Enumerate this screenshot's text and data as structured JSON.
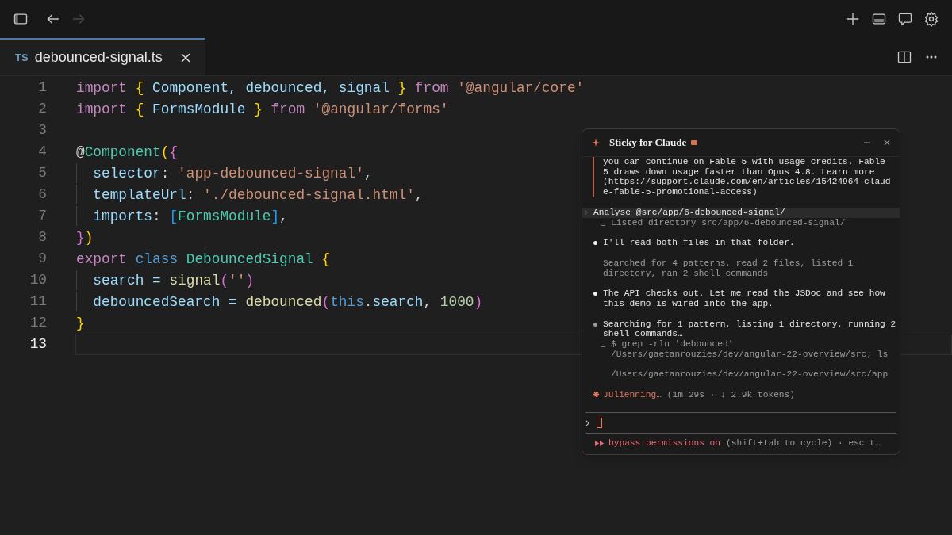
{
  "nav": {
    "back_disabled": false,
    "forward_disabled": true
  },
  "tab": {
    "lang": "TS",
    "label": "debounced-signal.ts",
    "selected": true
  },
  "editor": {
    "lines": [
      {
        "number": "1",
        "current": false,
        "indent_guide": false,
        "tokens": [
          {
            "text": "import ",
            "kind": "kw"
          },
          {
            "text": "{",
            "kind": "brace"
          },
          {
            "text": " Component, debounced, signal ",
            "kind": "id"
          },
          {
            "text": "}",
            "kind": "brace"
          },
          {
            "text": " from ",
            "kind": "kw"
          },
          {
            "text": "'@angular/core'",
            "kind": "str"
          }
        ]
      },
      {
        "number": "2",
        "current": false,
        "indent_guide": false,
        "tokens": [
          {
            "text": "import ",
            "kind": "kw"
          },
          {
            "text": "{",
            "kind": "brace"
          },
          {
            "text": " FormsModule ",
            "kind": "id"
          },
          {
            "text": "}",
            "kind": "brace"
          },
          {
            "text": " from ",
            "kind": "kw"
          },
          {
            "text": "'@angular/forms'",
            "kind": "str"
          }
        ]
      },
      {
        "number": "3",
        "current": false,
        "indent_guide": false
      },
      {
        "number": "4",
        "current": false,
        "indent_guide": false,
        "tokens": [
          {
            "text": "@",
            "kind": "plain"
          },
          {
            "text": "Component",
            "kind": "cls"
          },
          {
            "text": "(",
            "kind": "brace"
          },
          {
            "text": "{",
            "kind": "bracket2"
          }
        ]
      },
      {
        "number": "5",
        "current": false,
        "indent_guide": true,
        "tokens": [
          {
            "text": "selector",
            "kind": "id"
          },
          {
            "text": ": ",
            "kind": "plain"
          },
          {
            "text": "'app-debounced-signal'",
            "kind": "str"
          },
          {
            "text": ",",
            "kind": "plain"
          }
        ]
      },
      {
        "number": "6",
        "current": false,
        "indent_guide": true,
        "tokens": [
          {
            "text": "templateUrl",
            "kind": "id"
          },
          {
            "text": ": ",
            "kind": "plain"
          },
          {
            "text": "'./debounced-signal.html'",
            "kind": "str"
          },
          {
            "text": ",",
            "kind": "plain"
          }
        ]
      },
      {
        "number": "7",
        "current": false,
        "indent_guide": true,
        "tokens": [
          {
            "text": "imports",
            "kind": "id"
          },
          {
            "text": ": ",
            "kind": "plain"
          },
          {
            "text": "[",
            "kind": "bracket3"
          },
          {
            "text": "FormsModule",
            "kind": "cls"
          },
          {
            "text": "]",
            "kind": "bracket3"
          },
          {
            "text": ",",
            "kind": "plain"
          }
        ]
      },
      {
        "number": "8",
        "current": false,
        "indent_guide": false,
        "tokens": [
          {
            "text": "}",
            "kind": "bracket2"
          },
          {
            "text": ")",
            "kind": "brace"
          }
        ]
      },
      {
        "number": "9",
        "current": false,
        "indent_guide": false,
        "tokens": [
          {
            "text": "export ",
            "kind": "kw"
          },
          {
            "text": "class ",
            "kind": "storage"
          },
          {
            "text": "DebouncedSignal ",
            "kind": "cls"
          },
          {
            "text": "{",
            "kind": "brace"
          }
        ]
      },
      {
        "number": "10",
        "current": false,
        "indent_guide": true,
        "tokens": [
          {
            "text": "search = ",
            "kind": "id"
          },
          {
            "text": "signal",
            "kind": "fn"
          },
          {
            "text": "(",
            "kind": "bracket2"
          },
          {
            "text": "''",
            "kind": "str"
          },
          {
            "text": ")",
            "kind": "bracket2"
          }
        ]
      },
      {
        "number": "11",
        "current": false,
        "indent_guide": true,
        "tokens": [
          {
            "text": "debouncedSearch = ",
            "kind": "id"
          },
          {
            "text": "debounced",
            "kind": "fn"
          },
          {
            "text": "(",
            "kind": "bracket2"
          },
          {
            "text": "this",
            "kind": "storage"
          },
          {
            "text": ".",
            "kind": "plain"
          },
          {
            "text": "search",
            "kind": "id"
          },
          {
            "text": ", ",
            "kind": "plain"
          },
          {
            "text": "1000",
            "kind": "num"
          },
          {
            "text": ")",
            "kind": "bracket2"
          }
        ]
      },
      {
        "number": "12",
        "current": false,
        "indent_guide": false,
        "tokens": [
          {
            "text": "}",
            "kind": "brace"
          }
        ]
      },
      {
        "number": "13",
        "current": true,
        "indent_guide": false
      }
    ]
  },
  "sticky": {
    "title": "Sticky for Claude",
    "notice": "you can continue on Fable 5 with usage credits. Fable\n5 draws down usage faster than Opus 4.8. Learn more\n(https://support.claude.com/en/articles/15424964-claud\ne-fable-5-promotional-access)",
    "messages": [
      {
        "kind": "prompt",
        "text": "Analyse @src/app/6-debounced-signal/"
      },
      {
        "kind": "tool_result",
        "text": "Listed directory src/app/6-debounced-signal/"
      },
      {
        "kind": "message",
        "text": "I'll read both files in that folder."
      },
      {
        "kind": "summary",
        "text": "Searched for 4 patterns, read 2 files, listed 1\ndirectory, ran 2 shell commands"
      },
      {
        "kind": "message",
        "text": "The API checks out. Let me read the JSDoc and see how\nthis demo is wired into the app."
      },
      {
        "kind": "progress",
        "text": "Searching for 1 pattern, listing 1 directory, running 2\nshell commands…"
      },
      {
        "kind": "tool_result",
        "text": "$ grep -rln 'debounced'\n/Users/gaetanrouzies/dev/angular-22-overview/src; ls\n\n/Users/gaetanrouzies/dev/angular-22-overview/src/app"
      },
      {
        "kind": "status",
        "text": "Julienning…",
        "detail": "(1m 29s · ↓ 2.9k tokens)"
      }
    ],
    "footer": {
      "mode": "bypass permissions on",
      "hint": "(shift+tab to cycle) · esc t…"
    }
  }
}
